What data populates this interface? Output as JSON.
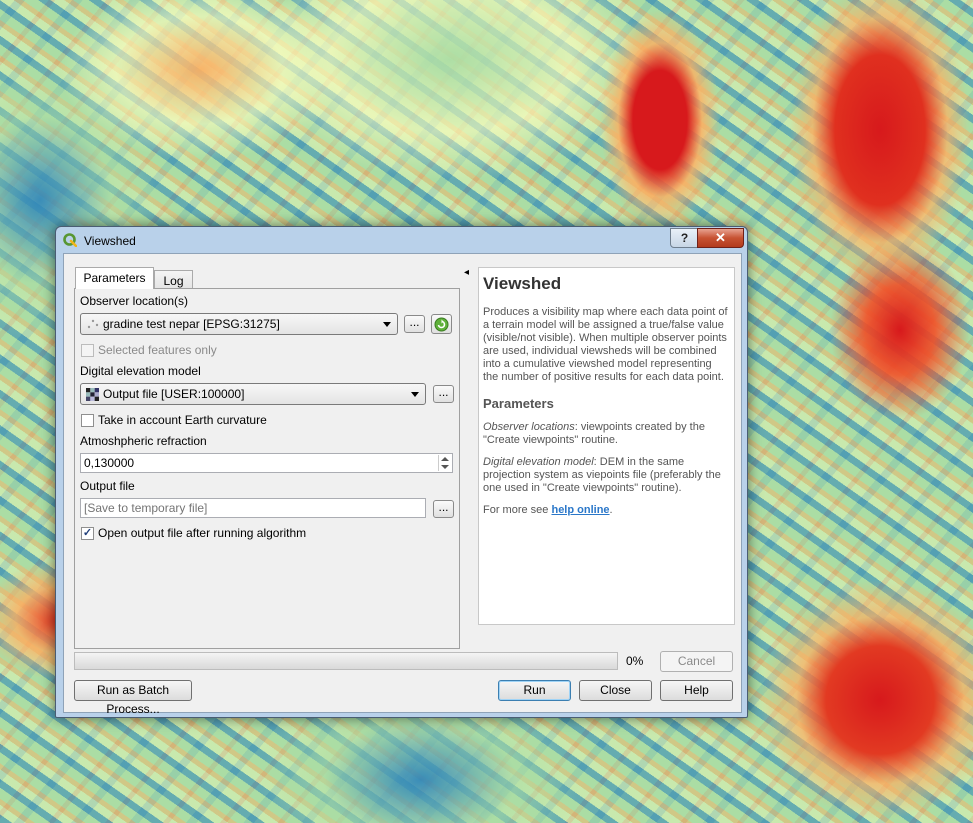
{
  "window": {
    "title": "Viewshed",
    "help_glyph": "?",
    "close_glyph": "✕"
  },
  "tabs": [
    {
      "label": "Parameters"
    },
    {
      "label": "Log"
    }
  ],
  "collapse_glyph": "◂",
  "params": {
    "observer": {
      "label": "Observer location(s)",
      "value": "gradine test nepar [EPSG:31275]",
      "browse": "..."
    },
    "selected_only": {
      "label": "Selected features only",
      "checked": false
    },
    "dem": {
      "label": "Digital elevation model",
      "value": "Output file [USER:100000]",
      "browse": "..."
    },
    "curvature": {
      "label": "Take in account Earth curvature",
      "checked": false
    },
    "refraction": {
      "label": "Atmoshpheric refraction",
      "value": "0,130000"
    },
    "output": {
      "label": "Output file",
      "placeholder": "[Save to temporary file]",
      "browse": "..."
    },
    "open_after": {
      "label": "Open output file after running algorithm",
      "checked": true,
      "check_glyph": "✓"
    }
  },
  "help": {
    "title": "Viewshed",
    "description": "Produces a visibility map where each data point of a terrain model will be assigned a true/false value (visible/not visible). When multiple observer points are used, individual viewsheds will be combined into a cumulative viewshed model representing the number of positive results for each data point.",
    "params_heading": "Parameters",
    "observer_term": "Observer locations",
    "observer_desc": ": viewpoints created by the \"Create viewpoints\" routine.",
    "dem_term": "Digital elevation model",
    "dem_desc": ": DEM in the same projection system as viepoints file (preferably the one used in \"Create viewpoints\" routine).",
    "more_prefix": "For more see ",
    "link": "help online",
    "more_suffix": "."
  },
  "progress": {
    "value": 0,
    "label": "0%"
  },
  "buttons": {
    "cancel": "Cancel",
    "batch": "Run as Batch Process...",
    "run": "Run",
    "close": "Close",
    "help": "Help"
  },
  "colors": {
    "accent": "#2a77c9",
    "qgis_green": "#589632"
  }
}
